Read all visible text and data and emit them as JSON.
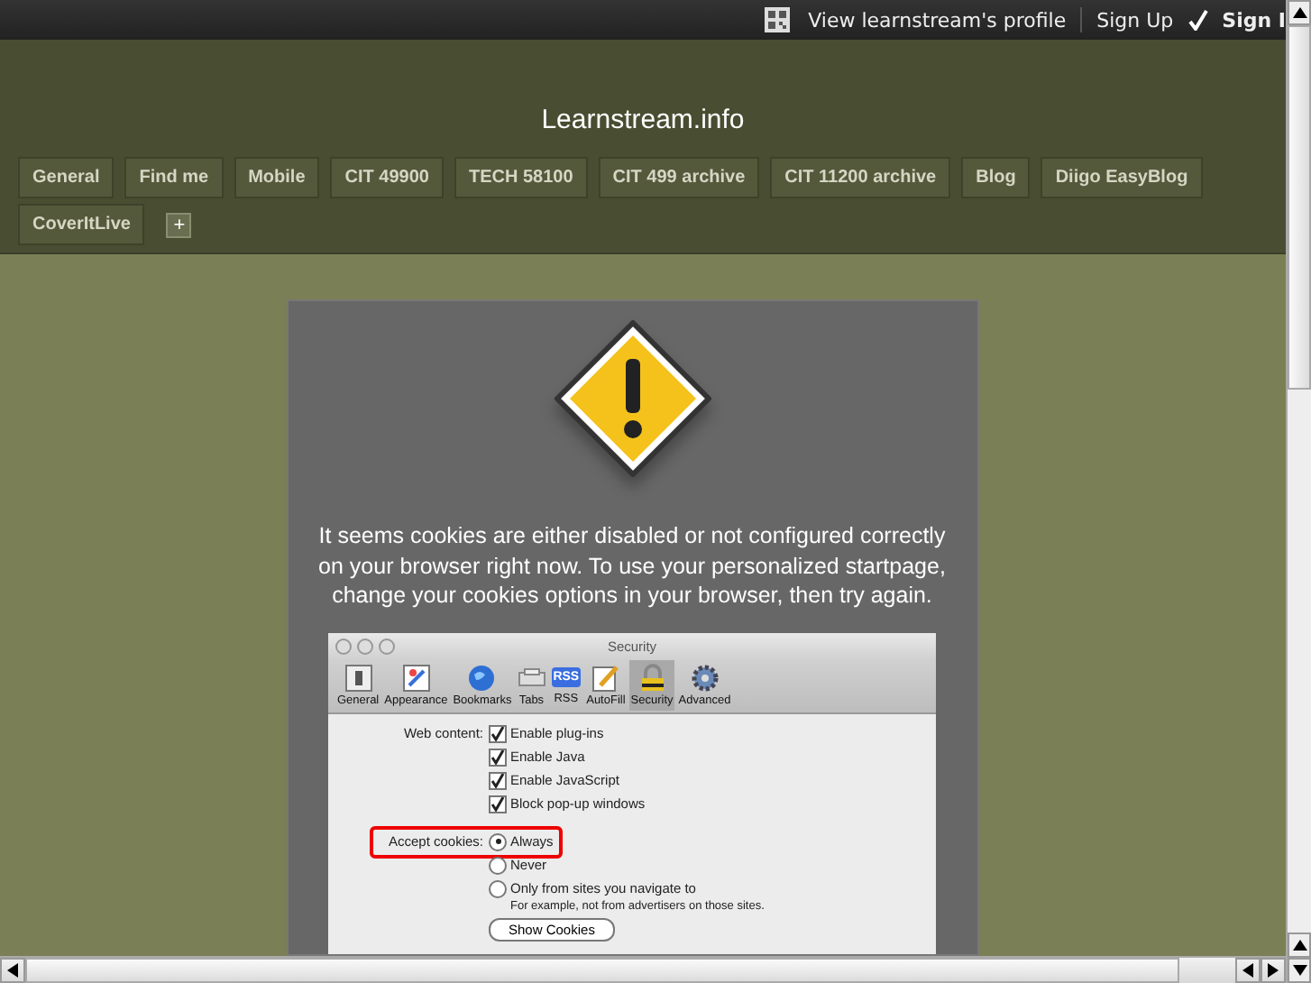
{
  "topbar": {
    "profile_link": "View learnstream's profile",
    "sign_up": "Sign Up",
    "sign_in": "Sign I"
  },
  "site_title": "Learnstream.info",
  "tabs": [
    {
      "label": "General"
    },
    {
      "label": "Find me"
    },
    {
      "label": "Mobile"
    },
    {
      "label": "CIT 49900"
    },
    {
      "label": "TECH 58100"
    },
    {
      "label": "CIT 499 archive"
    },
    {
      "label": "CIT 11200 archive"
    },
    {
      "label": "Blog"
    },
    {
      "label": "Diigo EasyBlog"
    },
    {
      "label": "CoverItLive"
    }
  ],
  "add_tab": "+",
  "message": "It seems cookies are either disabled or not configured correctly on your browser right now. To use your personalized startpage, change your cookies options in your browser, then try again.",
  "screenshot": {
    "window_title": "Security",
    "toolbar": [
      {
        "label": "General",
        "kind": "switch",
        "selected": false
      },
      {
        "label": "Appearance",
        "kind": "paint",
        "selected": false
      },
      {
        "label": "Bookmarks",
        "kind": "globe",
        "selected": false
      },
      {
        "label": "Tabs",
        "kind": "tabs",
        "selected": false
      },
      {
        "label": "RSS",
        "kind": "rss",
        "badge": "RSS",
        "selected": false
      },
      {
        "label": "AutoFill",
        "kind": "pencil",
        "selected": false
      },
      {
        "label": "Security",
        "kind": "lock",
        "selected": true
      },
      {
        "label": "Advanced",
        "kind": "gear",
        "selected": false
      }
    ],
    "web_content_label": "Web content:",
    "options": [
      {
        "label": "Enable plug-ins",
        "checked": true
      },
      {
        "label": "Enable Java",
        "checked": true
      },
      {
        "label": "Enable JavaScript",
        "checked": true
      },
      {
        "label": "Block pop-up windows",
        "checked": true
      }
    ],
    "cookies_label": "Accept cookies:",
    "radios": [
      {
        "label": "Always",
        "selected": true
      },
      {
        "label": "Never",
        "selected": false
      },
      {
        "label": "Only from sites you navigate to",
        "selected": false
      }
    ],
    "hint": "For example, not from advertisers on those sites.",
    "show_cookies_button": "Show Cookies"
  }
}
